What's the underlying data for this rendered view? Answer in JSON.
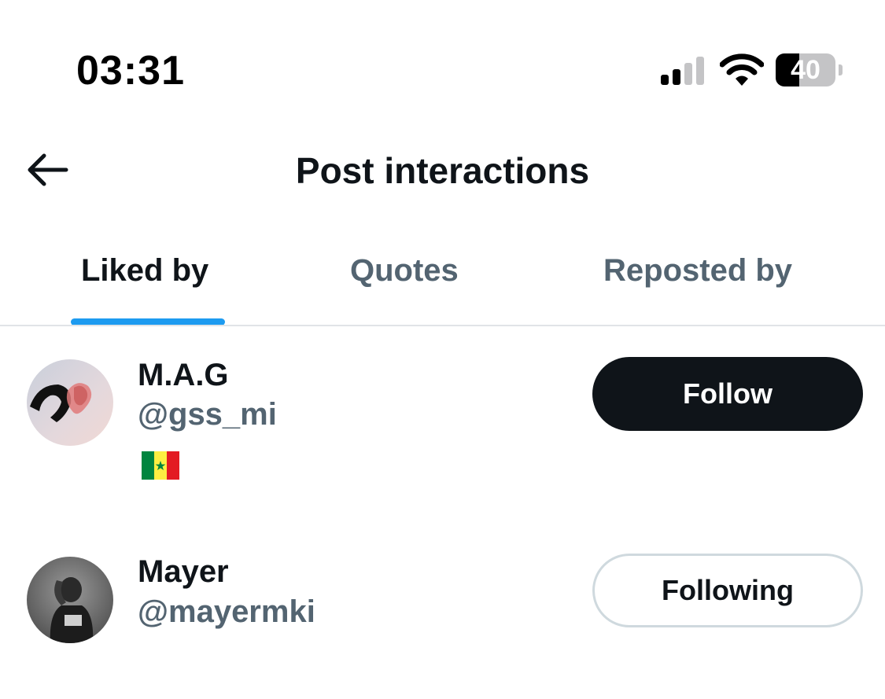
{
  "status_bar": {
    "time": "03:31",
    "battery_level": "40",
    "icons": [
      "signal-icon",
      "wifi-icon",
      "battery-icon"
    ]
  },
  "header": {
    "back_icon": "arrow-left-icon",
    "title": "Post interactions"
  },
  "tabs": [
    {
      "label": "Liked by",
      "active": true
    },
    {
      "label": "Quotes",
      "active": false
    },
    {
      "label": "Reposted by",
      "active": false
    }
  ],
  "users": [
    {
      "name": "M.A.G",
      "handle": "@gss_mi",
      "bio_emoji": "🇸🇳",
      "button_label": "Follow",
      "following": false
    },
    {
      "name": "Mayer",
      "handle": "@mayermki",
      "button_label": "Following",
      "following": true
    }
  ],
  "colors": {
    "accent": "#1d9bf0",
    "text_primary": "#0f1419",
    "text_secondary": "#536471",
    "follow_bg": "#0f1419",
    "following_border": "#cfd9de"
  }
}
